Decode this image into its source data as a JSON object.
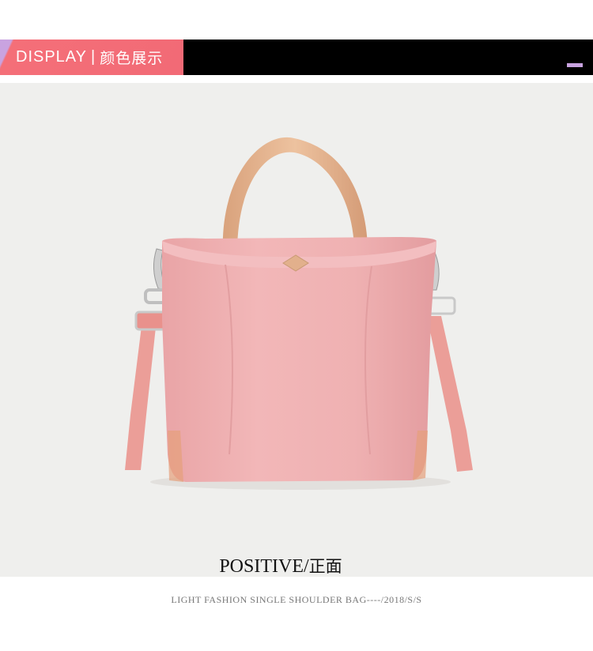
{
  "banner": {
    "label_en": "DISPLAY",
    "separator": "|",
    "label_cn": "颜色展示",
    "colors": {
      "bar": "#000000",
      "label_bg": "#f26a76",
      "accent": "#c9a3e0"
    }
  },
  "product": {
    "image": "pink-shoulder-bag",
    "body_color": "#f0b1b3",
    "handle_color": "#e3b38f",
    "strap_color": "#ec9d98"
  },
  "caption": {
    "title_en": "POSITIVE/",
    "title_cn": "正面",
    "subtitle": "LIGHT FASHION SINGLE SHOULDER BAG----/2018/S/S"
  }
}
